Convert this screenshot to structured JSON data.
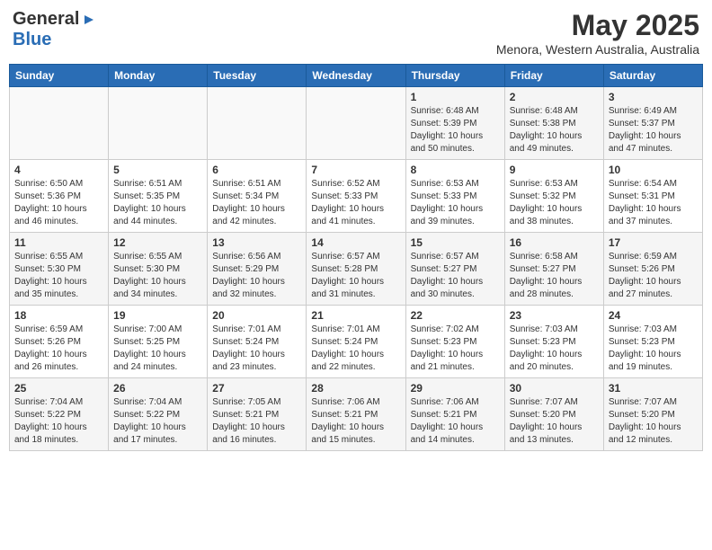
{
  "header": {
    "logo_general": "General",
    "logo_blue": "Blue",
    "month": "May 2025",
    "location": "Menora, Western Australia, Australia"
  },
  "days_of_week": [
    "Sunday",
    "Monday",
    "Tuesday",
    "Wednesday",
    "Thursday",
    "Friday",
    "Saturday"
  ],
  "weeks": [
    [
      {
        "day": "",
        "info": ""
      },
      {
        "day": "",
        "info": ""
      },
      {
        "day": "",
        "info": ""
      },
      {
        "day": "",
        "info": ""
      },
      {
        "day": "1",
        "info": "Sunrise: 6:48 AM\nSunset: 5:39 PM\nDaylight: 10 hours\nand 50 minutes."
      },
      {
        "day": "2",
        "info": "Sunrise: 6:48 AM\nSunset: 5:38 PM\nDaylight: 10 hours\nand 49 minutes."
      },
      {
        "day": "3",
        "info": "Sunrise: 6:49 AM\nSunset: 5:37 PM\nDaylight: 10 hours\nand 47 minutes."
      }
    ],
    [
      {
        "day": "4",
        "info": "Sunrise: 6:50 AM\nSunset: 5:36 PM\nDaylight: 10 hours\nand 46 minutes."
      },
      {
        "day": "5",
        "info": "Sunrise: 6:51 AM\nSunset: 5:35 PM\nDaylight: 10 hours\nand 44 minutes."
      },
      {
        "day": "6",
        "info": "Sunrise: 6:51 AM\nSunset: 5:34 PM\nDaylight: 10 hours\nand 42 minutes."
      },
      {
        "day": "7",
        "info": "Sunrise: 6:52 AM\nSunset: 5:33 PM\nDaylight: 10 hours\nand 41 minutes."
      },
      {
        "day": "8",
        "info": "Sunrise: 6:53 AM\nSunset: 5:33 PM\nDaylight: 10 hours\nand 39 minutes."
      },
      {
        "day": "9",
        "info": "Sunrise: 6:53 AM\nSunset: 5:32 PM\nDaylight: 10 hours\nand 38 minutes."
      },
      {
        "day": "10",
        "info": "Sunrise: 6:54 AM\nSunset: 5:31 PM\nDaylight: 10 hours\nand 37 minutes."
      }
    ],
    [
      {
        "day": "11",
        "info": "Sunrise: 6:55 AM\nSunset: 5:30 PM\nDaylight: 10 hours\nand 35 minutes."
      },
      {
        "day": "12",
        "info": "Sunrise: 6:55 AM\nSunset: 5:30 PM\nDaylight: 10 hours\nand 34 minutes."
      },
      {
        "day": "13",
        "info": "Sunrise: 6:56 AM\nSunset: 5:29 PM\nDaylight: 10 hours\nand 32 minutes."
      },
      {
        "day": "14",
        "info": "Sunrise: 6:57 AM\nSunset: 5:28 PM\nDaylight: 10 hours\nand 31 minutes."
      },
      {
        "day": "15",
        "info": "Sunrise: 6:57 AM\nSunset: 5:27 PM\nDaylight: 10 hours\nand 30 minutes."
      },
      {
        "day": "16",
        "info": "Sunrise: 6:58 AM\nSunset: 5:27 PM\nDaylight: 10 hours\nand 28 minutes."
      },
      {
        "day": "17",
        "info": "Sunrise: 6:59 AM\nSunset: 5:26 PM\nDaylight: 10 hours\nand 27 minutes."
      }
    ],
    [
      {
        "day": "18",
        "info": "Sunrise: 6:59 AM\nSunset: 5:26 PM\nDaylight: 10 hours\nand 26 minutes."
      },
      {
        "day": "19",
        "info": "Sunrise: 7:00 AM\nSunset: 5:25 PM\nDaylight: 10 hours\nand 24 minutes."
      },
      {
        "day": "20",
        "info": "Sunrise: 7:01 AM\nSunset: 5:24 PM\nDaylight: 10 hours\nand 23 minutes."
      },
      {
        "day": "21",
        "info": "Sunrise: 7:01 AM\nSunset: 5:24 PM\nDaylight: 10 hours\nand 22 minutes."
      },
      {
        "day": "22",
        "info": "Sunrise: 7:02 AM\nSunset: 5:23 PM\nDaylight: 10 hours\nand 21 minutes."
      },
      {
        "day": "23",
        "info": "Sunrise: 7:03 AM\nSunset: 5:23 PM\nDaylight: 10 hours\nand 20 minutes."
      },
      {
        "day": "24",
        "info": "Sunrise: 7:03 AM\nSunset: 5:23 PM\nDaylight: 10 hours\nand 19 minutes."
      }
    ],
    [
      {
        "day": "25",
        "info": "Sunrise: 7:04 AM\nSunset: 5:22 PM\nDaylight: 10 hours\nand 18 minutes."
      },
      {
        "day": "26",
        "info": "Sunrise: 7:04 AM\nSunset: 5:22 PM\nDaylight: 10 hours\nand 17 minutes."
      },
      {
        "day": "27",
        "info": "Sunrise: 7:05 AM\nSunset: 5:21 PM\nDaylight: 10 hours\nand 16 minutes."
      },
      {
        "day": "28",
        "info": "Sunrise: 7:06 AM\nSunset: 5:21 PM\nDaylight: 10 hours\nand 15 minutes."
      },
      {
        "day": "29",
        "info": "Sunrise: 7:06 AM\nSunset: 5:21 PM\nDaylight: 10 hours\nand 14 minutes."
      },
      {
        "day": "30",
        "info": "Sunrise: 7:07 AM\nSunset: 5:20 PM\nDaylight: 10 hours\nand 13 minutes."
      },
      {
        "day": "31",
        "info": "Sunrise: 7:07 AM\nSunset: 5:20 PM\nDaylight: 10 hours\nand 12 minutes."
      }
    ]
  ]
}
